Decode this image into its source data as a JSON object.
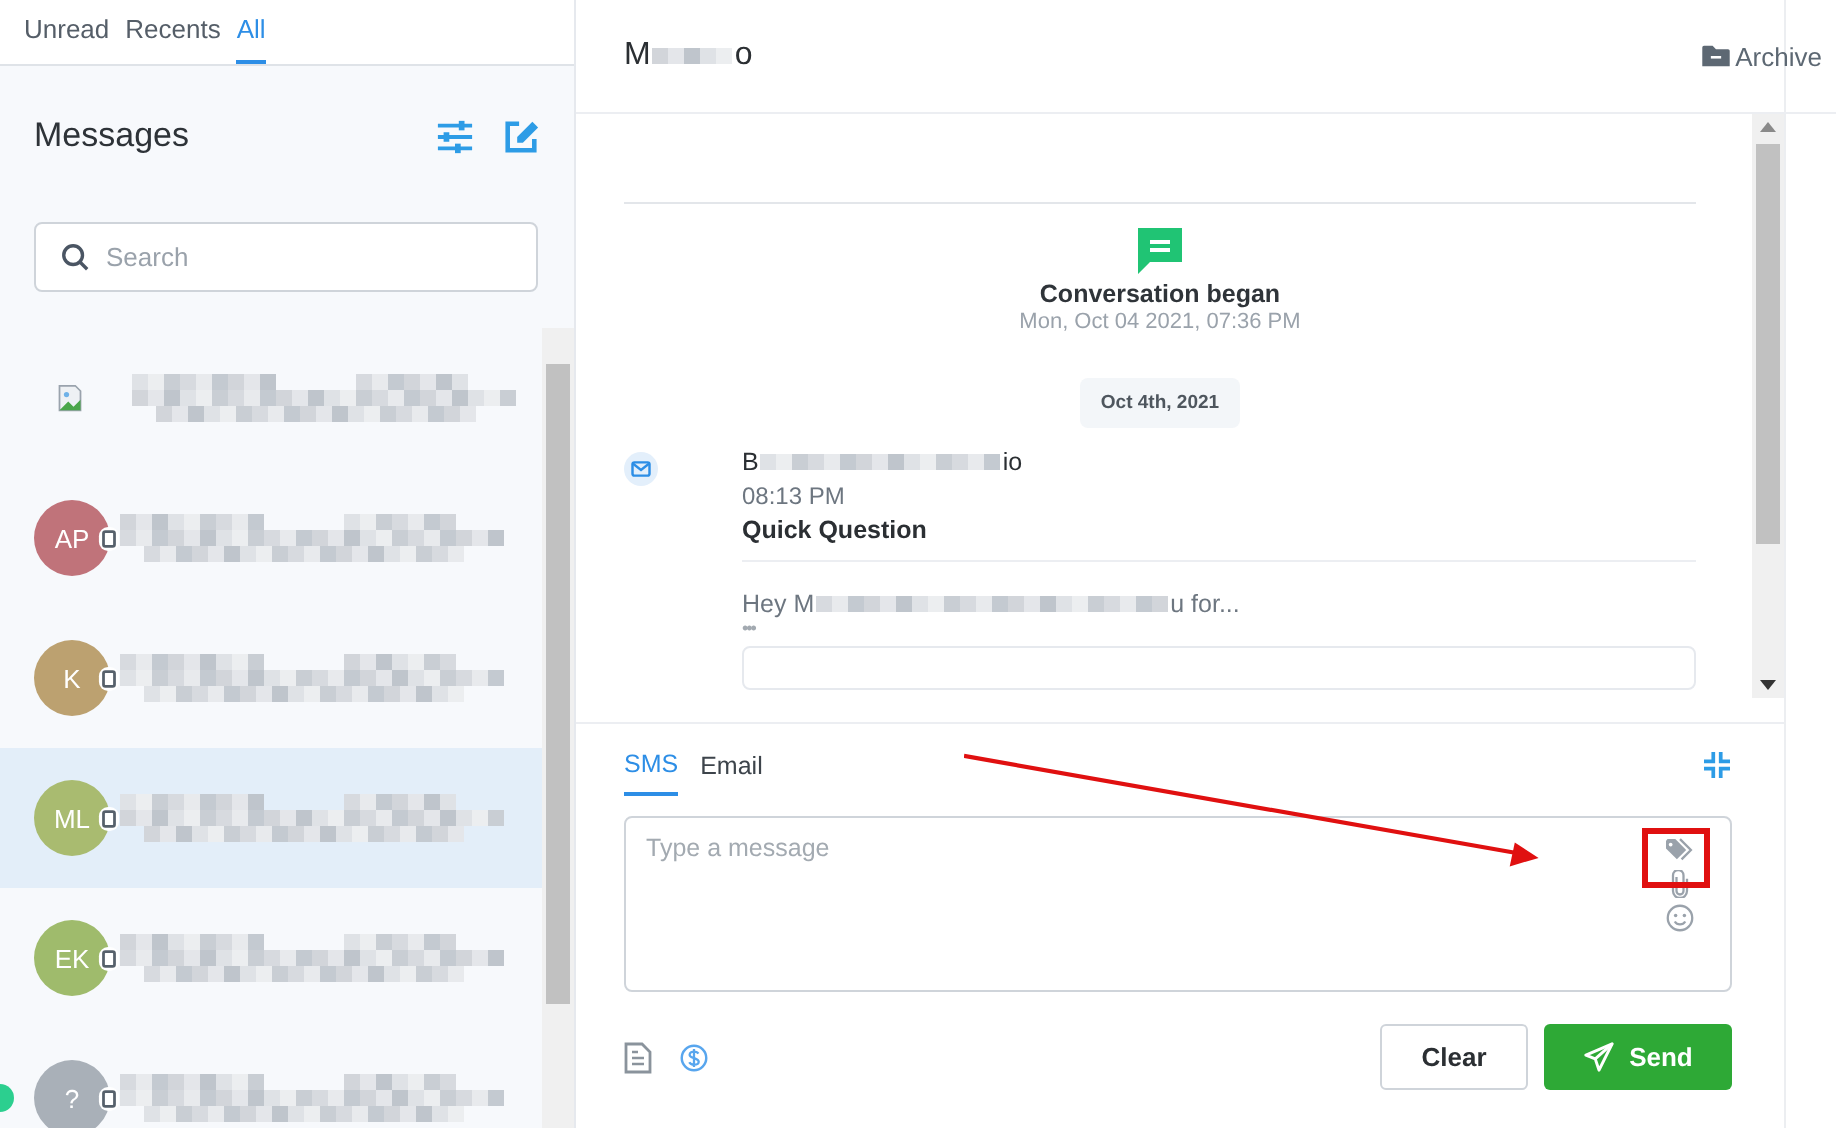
{
  "filter_tabs": [
    {
      "label": "Unread",
      "selected": false
    },
    {
      "label": "Recents",
      "selected": false
    },
    {
      "label": "All",
      "selected": true
    }
  ],
  "sidebar": {
    "title": "Messages",
    "search": {
      "placeholder": "Search"
    },
    "contacts": [
      {
        "kind": "image",
        "selected": false,
        "online": false
      },
      {
        "kind": "initials",
        "initials": "AP",
        "color": "#c0737a",
        "selected": false,
        "online": false
      },
      {
        "kind": "initials",
        "initials": "K",
        "color": "#bca170",
        "selected": false,
        "online": false
      },
      {
        "kind": "initials",
        "initials": "ML",
        "color": "#a9bb70",
        "selected": true,
        "online": false
      },
      {
        "kind": "initials",
        "initials": "EK",
        "color": "#9fbb6c",
        "selected": false,
        "online": false
      },
      {
        "kind": "initials",
        "initials": "?",
        "color": "#a9b0b8",
        "selected": false,
        "online": true
      }
    ]
  },
  "conversation": {
    "title_start": "M",
    "title_end": "o",
    "archive": "Archive",
    "began": {
      "title": "Conversation began",
      "time": "Mon, Oct 04 2021, 07:36 PM"
    },
    "date_chip": "Oct 4th, 2021",
    "message": {
      "sender_start": "B",
      "sender_end": "io",
      "time": "08:13 PM",
      "subject": "Quick Question",
      "preview_start": "Hey M",
      "preview_end": "u for...",
      "more": "•••"
    }
  },
  "composer": {
    "tabs": [
      {
        "label": "SMS",
        "selected": true
      },
      {
        "label": "Email",
        "selected": false
      }
    ],
    "placeholder": "Type a message",
    "buttons": {
      "clear": "Clear",
      "send": "Send"
    }
  }
}
